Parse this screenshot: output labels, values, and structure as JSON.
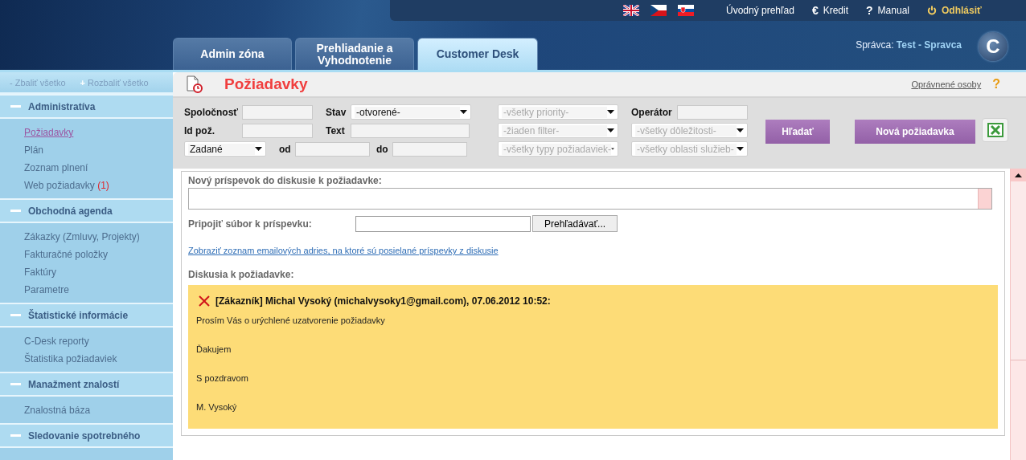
{
  "header": {
    "top_links": [
      {
        "kind": "plain",
        "label": "Úvodný prehľad"
      },
      {
        "kind": "credit",
        "icon": "€",
        "label": "Kredit"
      },
      {
        "kind": "help",
        "icon": "?",
        "label": "Manual"
      },
      {
        "kind": "logout",
        "label": "Odhlásiť"
      }
    ],
    "admin_label": "Správca:",
    "admin_name": "Test - Spravca",
    "logo_letter": "C"
  },
  "tabs": [
    {
      "label": "Admin zóna",
      "selected": false
    },
    {
      "label": "Prehliadanie a Vyhodnotenie",
      "selected": false
    },
    {
      "label": "Customer Desk",
      "selected": true
    }
  ],
  "sidebar": {
    "collapse_icon": "-",
    "collapse_label": "Zbaliť všetko",
    "expand_icon": "+",
    "expand_label": "Rozbaliť všetko",
    "sections": [
      {
        "title": "Administratíva",
        "expanded": true,
        "items": [
          {
            "label": "Požiadavky",
            "selected": true
          },
          {
            "label": "Plán",
            "selected": false
          },
          {
            "label": "Zoznam plnení",
            "selected": false
          },
          {
            "label": "Web požiadavky",
            "badge": "(1)",
            "selected": false
          }
        ]
      },
      {
        "title": "Obchodná agenda",
        "expanded": true,
        "items": [
          {
            "label": "Zákazky (Zmluvy, Projekty)",
            "selected": false
          },
          {
            "label": "Fakturačné položky",
            "selected": false
          },
          {
            "label": "Faktúry",
            "selected": false
          },
          {
            "label": "Parametre",
            "selected": false
          }
        ]
      },
      {
        "title": "Štatistické informácie",
        "expanded": true,
        "items": [
          {
            "label": "C-Desk reporty",
            "selected": false
          },
          {
            "label": "Štatistika požiadaviek",
            "selected": false
          }
        ]
      },
      {
        "title": "Manažment znalostí",
        "expanded": true,
        "items": [
          {
            "label": "Znalostná báza",
            "selected": false
          }
        ]
      },
      {
        "title": "Sledovanie spotrebného",
        "expanded": true
      }
    ]
  },
  "page": {
    "title": "Požiadavky",
    "link": "Oprávnené osoby",
    "help_icon": "?"
  },
  "filters": {
    "fields": [
      {
        "label": "Spoločnosť",
        "kind": "input"
      },
      {
        "label": "Stav",
        "kind": "select",
        "value": "-otvorené-",
        "disabled": false
      },
      {
        "label": "Id pož.",
        "kind": "input"
      },
      {
        "label": "Text",
        "kind": "input"
      },
      {
        "kind": "select",
        "value": "Zadané",
        "disabled": false
      },
      {
        "label": "od",
        "kind": "input"
      },
      {
        "label": "do",
        "kind": "input"
      }
    ],
    "dropdowns": [
      {
        "value": "-všetky priority-",
        "disabled": true
      },
      {
        "value": "-žiaden filter-",
        "disabled": true
      },
      {
        "value": "-všetky typy požiadaviek-",
        "disabled": true
      },
      {
        "value": "-všetky dôležitosti-",
        "disabled": true
      },
      {
        "value": "-všetky oblasti služieb-",
        "disabled": true
      }
    ],
    "operator": {
      "label": "Operátor"
    },
    "buttons": [
      {
        "label": "Hľadať"
      },
      {
        "label": "Nová požiadavka"
      }
    ]
  },
  "discussion": {
    "new_post_label": "Nový príspevok do diskusie k požiadavke:",
    "attach_label": "Pripojiť súbor k príspevku:",
    "browse_button": "Prehľadávať...",
    "emails_link": "Zobraziť zoznam emailových adries, na ktoré sú posielané príspevky z diskusie",
    "list_label": "Diskusia k požiadavke:",
    "posts": [
      {
        "header": "[Zákazník] Michal Vysoký (michalvysoky1@gmail.com), 07.06.2012 10:52:",
        "paragraphs": [
          "Prosím Vás o urýchlené uzatvorenie požiadavky",
          "Ďakujem",
          "S pozdravom",
          "M. Vysoký"
        ]
      }
    ]
  }
}
